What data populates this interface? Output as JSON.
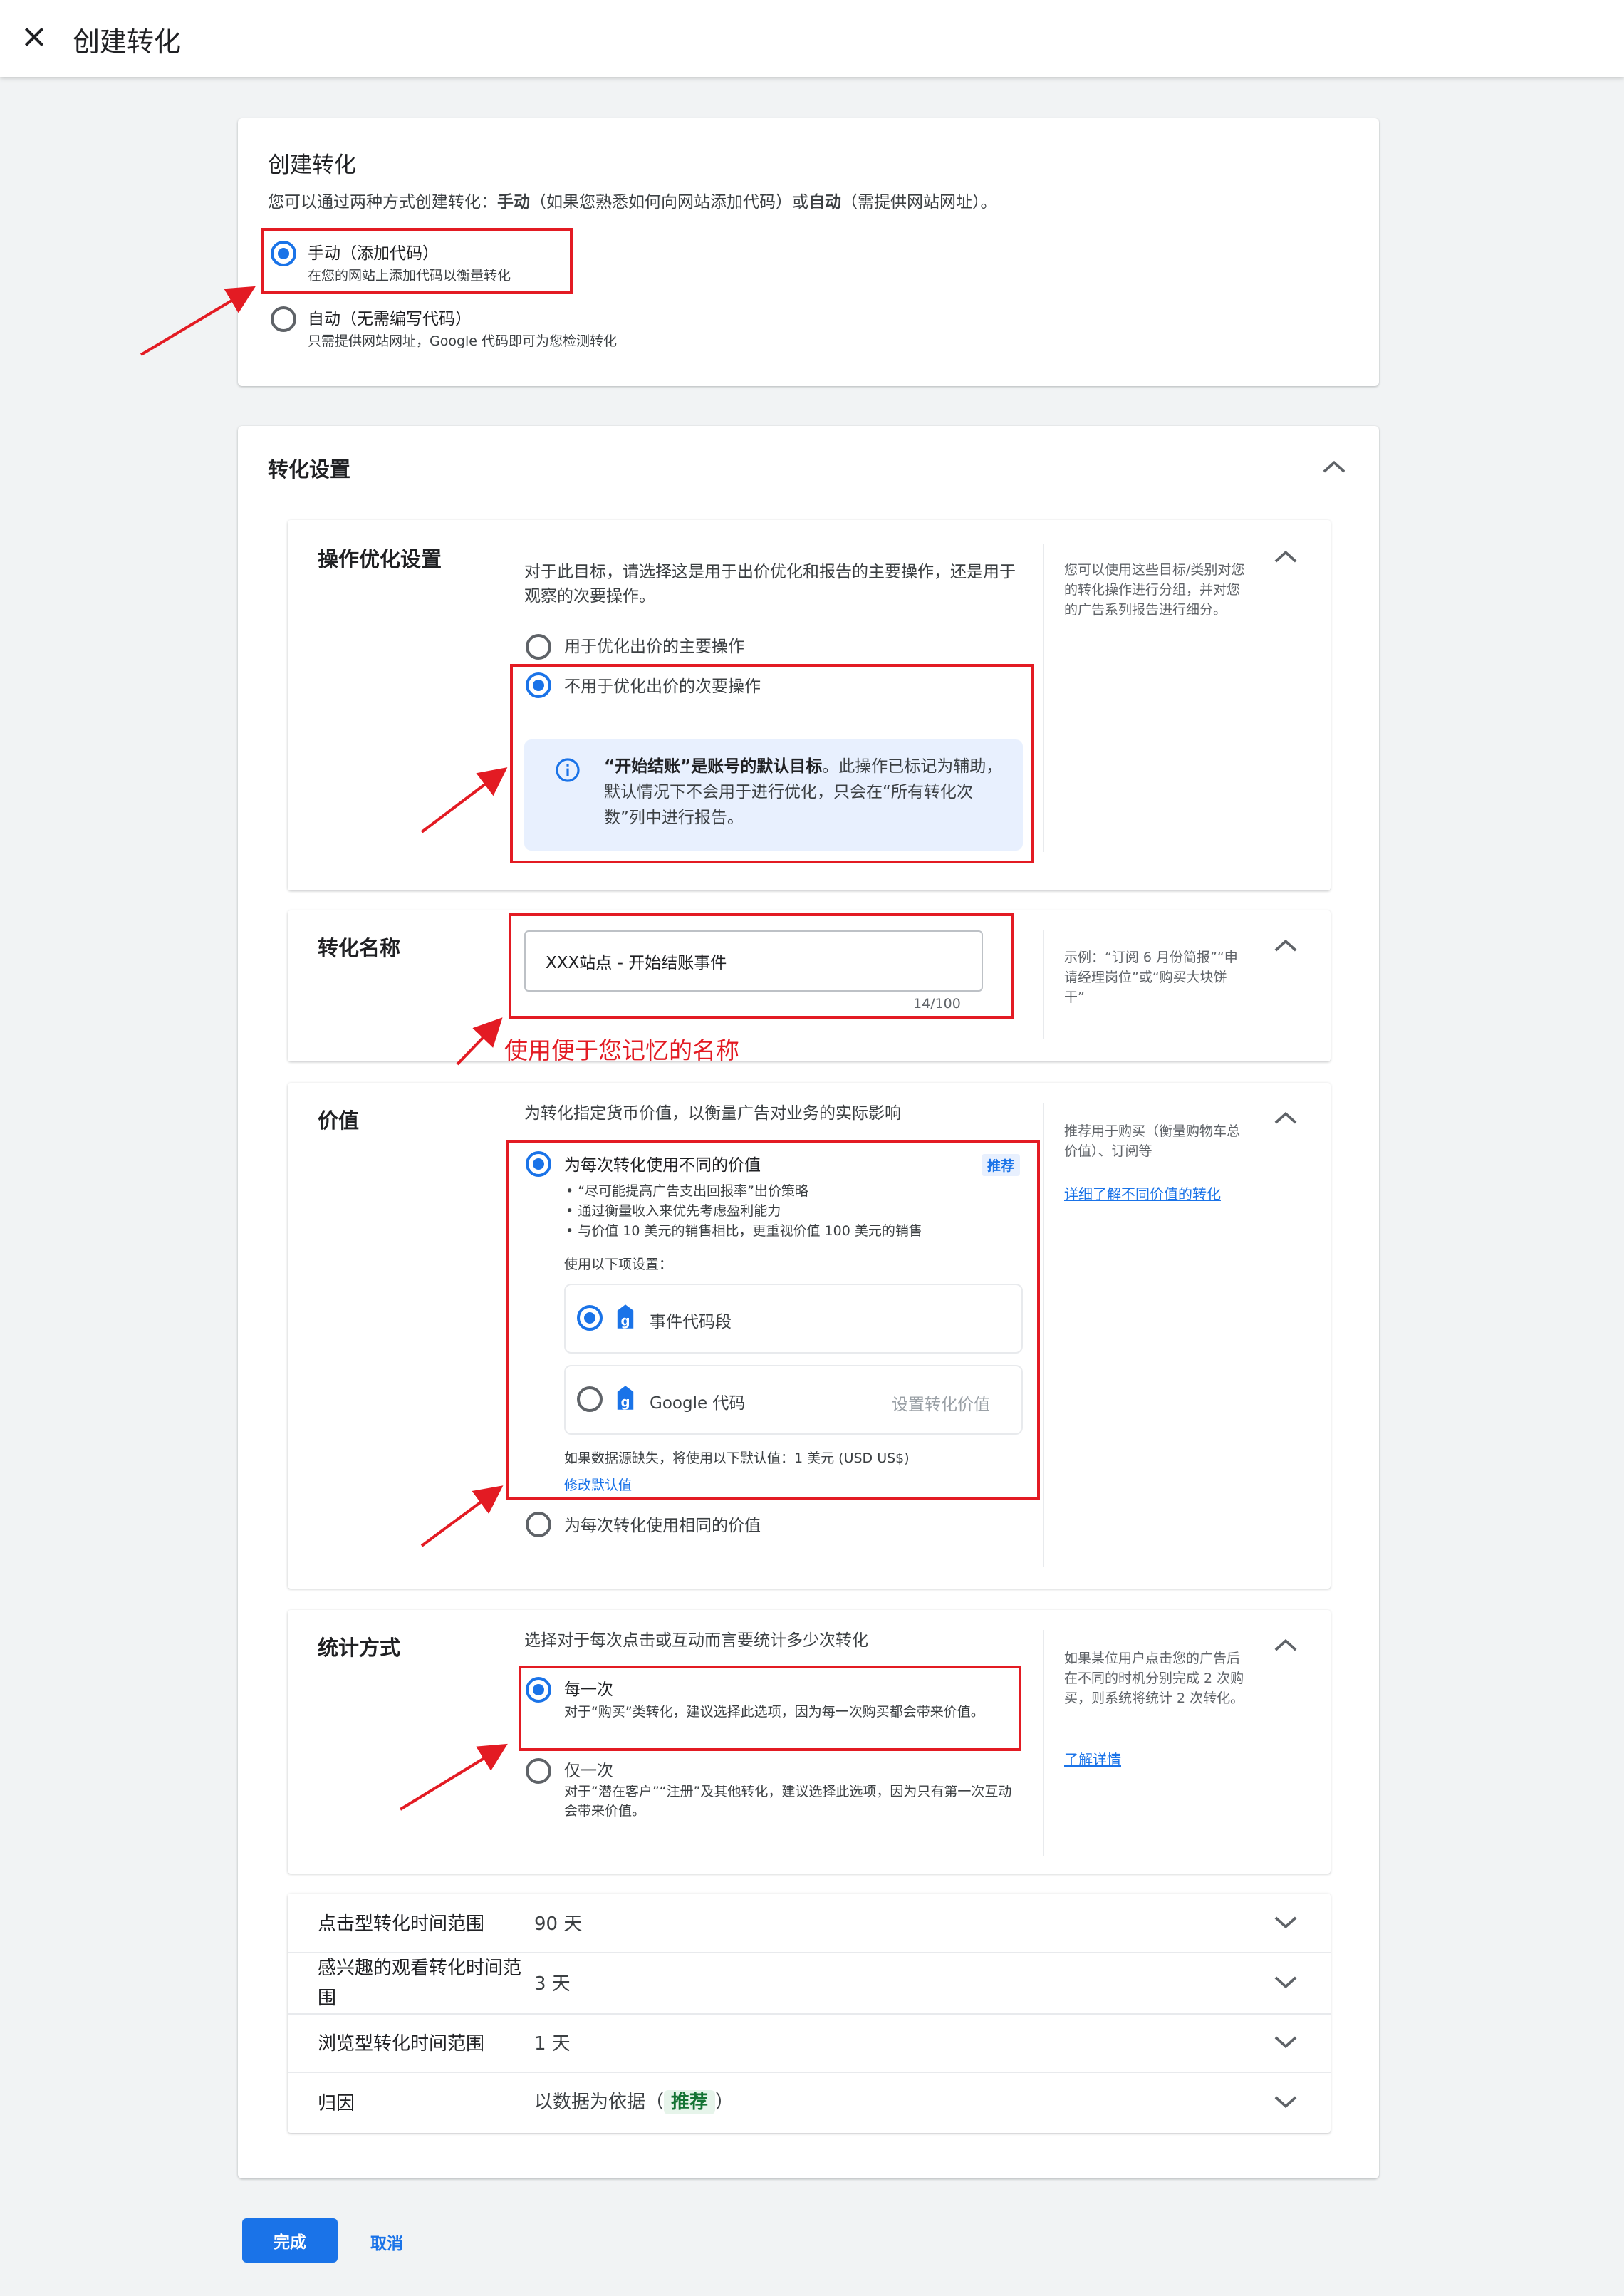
{
  "header": {
    "title": "创建转化"
  },
  "create": {
    "title": "创建转化",
    "desc_prefix": "您可以通过两种方式创建转化：",
    "desc_manual": "手动",
    "desc_mid": "（如果您熟悉如何向网站添加代码）或",
    "desc_auto": "自动",
    "desc_suffix": "（需提供网站网址）。",
    "options": [
      {
        "label": "手动（添加代码）",
        "sub": "在您的网站上添加代码以衡量转化",
        "selected": true
      },
      {
        "label": "自动（无需编写代码）",
        "sub": "只需提供网站网址，Google 代码即可为您检测转化",
        "selected": false
      }
    ]
  },
  "settings": {
    "title": "转化设置",
    "optimization": {
      "title": "操作优化设置",
      "desc": "对于此目标，请选择这是用于出价优化和报告的主要操作，还是用于观察的次要操作。",
      "options": [
        {
          "label": "用于优化出价的主要操作",
          "selected": false
        },
        {
          "label": "不用于优化出价的次要操作",
          "selected": true
        }
      ],
      "info_bold": "“开始结账”是账号的默认目标",
      "info_rest": "。此操作已标记为辅助，默认情况下不会用于进行优化，只会在“所有转化次数”列中进行报告。",
      "help": "您可以使用这些目标/类别对您的转化操作进行分组，并对您的广告系列报告进行细分。"
    },
    "name": {
      "title": "转化名称",
      "value": "XXX站点 - 开始结账事件",
      "counter": "14/100",
      "help": "示例：“订阅 6 月份简报”“申请经理岗位”或“购买大块饼干”",
      "annotation": "使用便于您记忆的名称"
    },
    "value": {
      "title": "价值",
      "desc": "为转化指定货币价值，以衡量广告对业务的实际影响",
      "option_diff": "为每次转化使用不同的价值",
      "badge": "推荐",
      "bullets": [
        "“尽可能提高广告支出回报率”出价策略",
        "通过衡量收入来优先考虑盈利能力",
        "与价值 10 美元的销售相比，更重视价值 100 美元的销售"
      ],
      "use_label": "使用以下项设置：",
      "sources": [
        {
          "label": "事件代码段",
          "selected": true,
          "action": ""
        },
        {
          "label": "Google 代码",
          "selected": false,
          "action": "设置转化价值"
        }
      ],
      "default_note": "如果数据源缺失，将使用以下默认值：1 美元 (USD US$)",
      "edit_default": "修改默认值",
      "option_same": "为每次转化使用相同的价值",
      "help": "推荐用于购买（衡量购物车总价值）、订阅等",
      "help_link": "详细了解不同价值的转化"
    },
    "count": {
      "title": "统计方式",
      "desc": "选择对于每次点击或互动而言要统计多少次转化",
      "options": [
        {
          "label": "每一次",
          "sub": "对于“购买”类转化，建议选择此选项，因为每一次购买都会带来价值。",
          "selected": true
        },
        {
          "label": "仅一次",
          "sub": "对于“潜在客户”“注册”及其他转化，建议选择此选项，因为只有第一次互动会带来价值。",
          "selected": false
        }
      ],
      "help": "如果某位用户点击您的广告后在不同的时机分别完成 2 次购买，则系统将统计 2 次转化。",
      "help_link": "了解详情"
    },
    "rows": [
      {
        "label": "点击型转化时间范围",
        "value": "90 天"
      },
      {
        "label": "感兴趣的观看转化时间范围",
        "value": "3 天"
      },
      {
        "label": "浏览型转化时间范围",
        "value": "1 天"
      },
      {
        "label": "归因",
        "value": "以数据为依据（",
        "badge": "推荐",
        "value_end": "）"
      }
    ]
  },
  "footer": {
    "done": "完成",
    "cancel": "取消"
  },
  "colors": {
    "accent": "#1a73e8",
    "annotation": "#e31b23",
    "info_bg": "#e8f0fe",
    "badge_green": "#e6f4ea"
  }
}
